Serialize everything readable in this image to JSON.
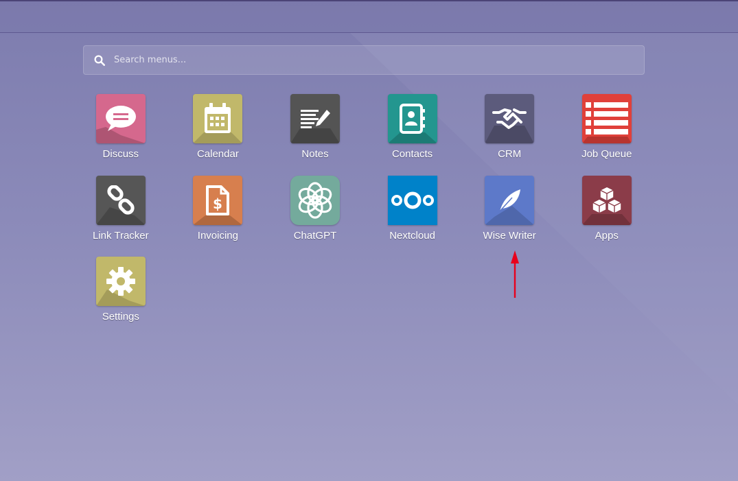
{
  "search": {
    "placeholder": "Search menus..."
  },
  "apps": [
    {
      "name": "Discuss",
      "icon": "chat-bubble-icon",
      "color": "#d5688d"
    },
    {
      "name": "Calendar",
      "icon": "calendar-icon",
      "color": "#c1b86a"
    },
    {
      "name": "Notes",
      "icon": "notes-pencil-icon",
      "color": "#545454"
    },
    {
      "name": "Contacts",
      "icon": "address-book-icon",
      "color": "#23968f"
    },
    {
      "name": "CRM",
      "icon": "handshake-icon",
      "color": "#5c5b7c"
    },
    {
      "name": "Job Queue",
      "icon": "list-icon",
      "color": "#e0403a"
    },
    {
      "name": "Link Tracker",
      "icon": "link-icon",
      "color": "#565656"
    },
    {
      "name": "Invoicing",
      "icon": "invoice-dollar-icon",
      "color": "#d77f4e"
    },
    {
      "name": "ChatGPT",
      "icon": "openai-knot-icon",
      "color": "#74aa9c"
    },
    {
      "name": "Nextcloud",
      "icon": "nextcloud-icon",
      "color": "#0082c9"
    },
    {
      "name": "Wise Writer",
      "icon": "feather-icon",
      "color": "#5d79c9"
    },
    {
      "name": "Apps",
      "icon": "cubes-icon",
      "color": "#8b3c49"
    },
    {
      "name": "Settings",
      "icon": "gear-icon",
      "color": "#c1b86a"
    }
  ],
  "annotation": {
    "icon": "red-arrow-up-icon",
    "color": "#e8001c"
  }
}
